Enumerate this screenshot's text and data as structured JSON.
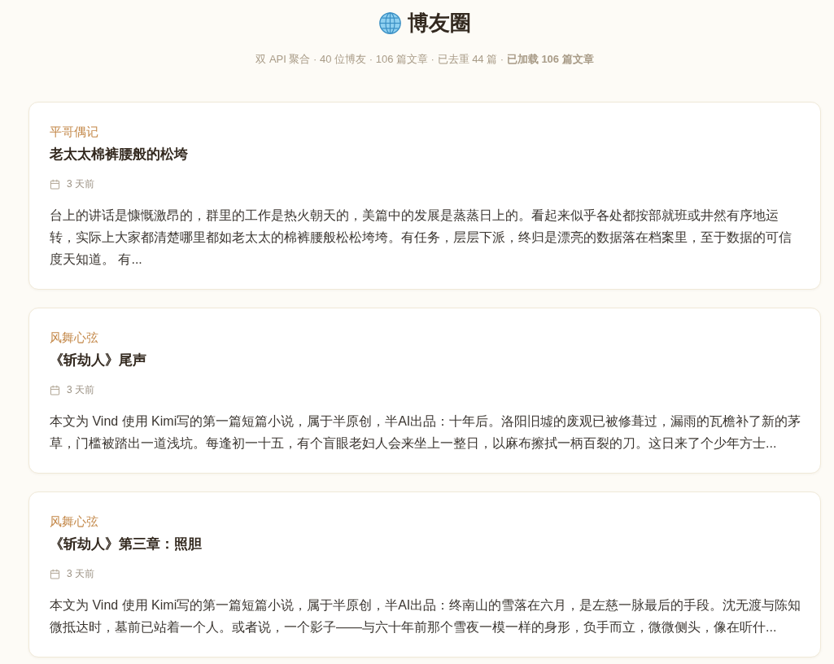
{
  "header": {
    "title": "博友圈",
    "stats": "双 API 聚合 · 40 位博友 · 106 篇文章 · 已去重 44 篇 · **已加载 106 篇文章**"
  },
  "posts": [
    {
      "author": "平哥偶记",
      "title": "老太太棉裤腰般的松垮",
      "date": "3 天前",
      "excerpt": "台上的讲话是慷慨激昂的，群里的工作是热火朝天的，美篇中的发展是蒸蒸日上的。看起来似乎各处都按部就班或井然有序地运转，实际上大家都清楚哪里都如老太太的棉裤腰般松松垮垮。有任务，层层下派，终归是漂亮的数据落在档案里，至于数据的可信度天知道。 有..."
    },
    {
      "author": "风舞心弦",
      "title": "《斩劫人》尾声",
      "date": "3 天前",
      "excerpt": "本文为 Vind 使用 Kimi写的第一篇短篇小说，属于半原创，半AI出品：十年后。洛阳旧墟的废观已被修葺过，漏雨的瓦檐补了新的茅草，门槛被踏出一道浅坑。每逢初一十五，有个盲眼老妇人会来坐上一整日，以麻布擦拭一柄百裂的刀。这日来了个少年方士..."
    },
    {
      "author": "风舞心弦",
      "title": "《斩劫人》第三章：照胆",
      "date": "3 天前",
      "excerpt": "本文为 Vind 使用 Kimi写的第一篇短篇小说，属于半原创，半AI出品：终南山的雪落在六月，是左慈一脉最后的手段。沈无渡与陈知微抵达时，墓前已站着一个人。或者说，一个影子——与六十年前那个雪夜一模一样的身形，负手而立，微微侧头，像在听什..."
    }
  ]
}
